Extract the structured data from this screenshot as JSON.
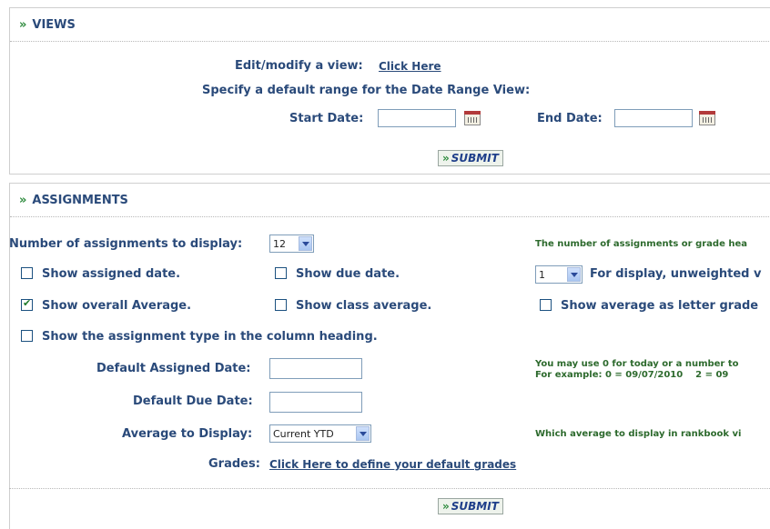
{
  "views": {
    "title": "VIEWS",
    "edit_label": "Edit/modify a view:",
    "edit_link": "Click Here",
    "range_label": "Specify a default range for the Date Range View:",
    "start_label": "Start Date:",
    "start_value": "",
    "end_label": "End Date:",
    "end_value": "",
    "submit_label": "SUBMIT"
  },
  "assignments": {
    "title": "ASSIGNMENTS",
    "num_label": "Number of assignments to display:",
    "num_value": "12",
    "num_note": "The number of assignments or grade hea",
    "show_assigned_date": {
      "label": "Show assigned date.",
      "checked": false
    },
    "show_due_date": {
      "label": "Show due date.",
      "checked": false
    },
    "display_select_value": "1",
    "display_note": "For display, unweighted v",
    "show_overall_avg": {
      "label": "Show overall Average.",
      "checked": true
    },
    "show_class_avg": {
      "label": "Show class average.",
      "checked": false
    },
    "show_letter": {
      "label": "Show average as letter grade",
      "checked": false
    },
    "show_type": {
      "label": "Show the assignment type in the column heading.",
      "checked": false
    },
    "default_assigned_label": "Default Assigned Date:",
    "default_assigned_value": "",
    "default_due_label": "Default Due Date:",
    "default_due_value": "",
    "date_note_line1": "You may use 0 for today or a number to",
    "date_note_line2": "For example: 0 = 09/07/2010    2 = 09",
    "avg_label": "Average to Display:",
    "avg_value": "Current YTD",
    "avg_note": "Which average to display in rankbook vi",
    "grades_label": "Grades:",
    "grades_link": "Click Here to define your default grades",
    "submit_label": "SUBMIT"
  }
}
